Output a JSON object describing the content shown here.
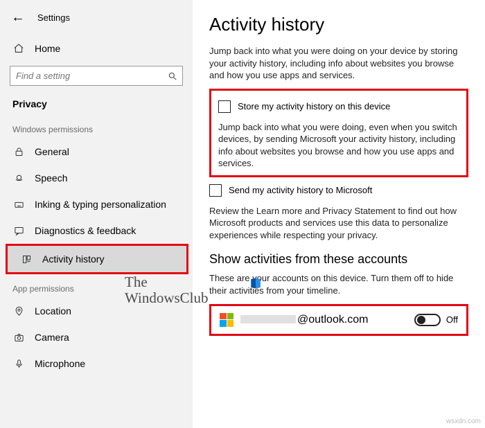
{
  "header": {
    "title": "Settings"
  },
  "sidebar": {
    "home": "Home",
    "search_placeholder": "Find a setting",
    "category": "Privacy",
    "group1_label": "Windows permissions",
    "group1": [
      {
        "label": "General"
      },
      {
        "label": "Speech"
      },
      {
        "label": "Inking & typing personalization"
      },
      {
        "label": "Diagnostics & feedback"
      },
      {
        "label": "Activity history"
      }
    ],
    "group2_label": "App permissions",
    "group2": [
      {
        "label": "Location"
      },
      {
        "label": "Camera"
      },
      {
        "label": "Microphone"
      }
    ]
  },
  "main": {
    "title": "Activity history",
    "intro": "Jump back into what you were doing on your device by storing your activity history, including info about websites you browse and how you use apps and services.",
    "checkbox1": "Store my activity history on this device",
    "para2": "Jump back into what you were doing, even when you switch devices, by sending Microsoft your activity history, including info about websites you browse and how you use apps and services.",
    "checkbox2": "Send my activity history to Microsoft",
    "review": "Review the Learn more and Privacy Statement to find out how Microsoft products and services use this data to personalize experiences while respecting your privacy.",
    "accounts_head": "Show activities from these accounts",
    "accounts_desc": "These are your accounts on this device. Turn them off to hide their activities from your timeline.",
    "account_suffix": "@outlook.com",
    "toggle_state": "Off"
  },
  "watermark": {
    "line1": "The",
    "line2": "WindowsClub"
  },
  "footer": "wsxdn.com"
}
